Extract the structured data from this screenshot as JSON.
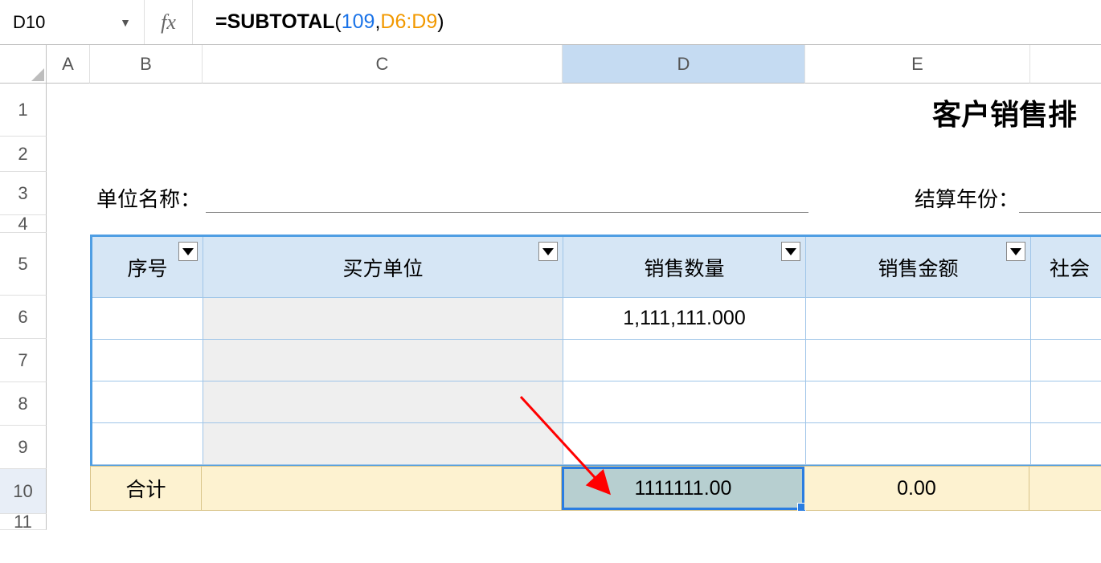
{
  "formula_bar": {
    "cell_ref": "D10",
    "fx_label": "fx",
    "formula_prefix": "=",
    "function_name": "SUBTOTAL",
    "open_paren": "(",
    "arg1": "109",
    "comma": ", ",
    "arg2": "D6:D9",
    "close_paren": ")"
  },
  "columns": {
    "A": "A",
    "B": "B",
    "C": "C",
    "D": "D",
    "E": "E",
    "F": ""
  },
  "rows": [
    "1",
    "2",
    "3",
    "4",
    "5",
    "6",
    "7",
    "8",
    "9",
    "10",
    "11"
  ],
  "title": "客户销售排",
  "labels": {
    "unit_name": "单位名称：",
    "settlement_year": "结算年份："
  },
  "table_headers": {
    "seq": "序号",
    "buyer": "买方单位",
    "qty": "销售数量",
    "amount": "销售金额",
    "social": "社会"
  },
  "table_data": {
    "row6": {
      "qty": "1,111,111.000"
    },
    "row7": {
      "qty": ""
    },
    "row8": {
      "qty": ""
    },
    "row9": {
      "qty": ""
    }
  },
  "totals": {
    "label": "合计",
    "qty": "1111111.00",
    "amount": "0.00"
  }
}
